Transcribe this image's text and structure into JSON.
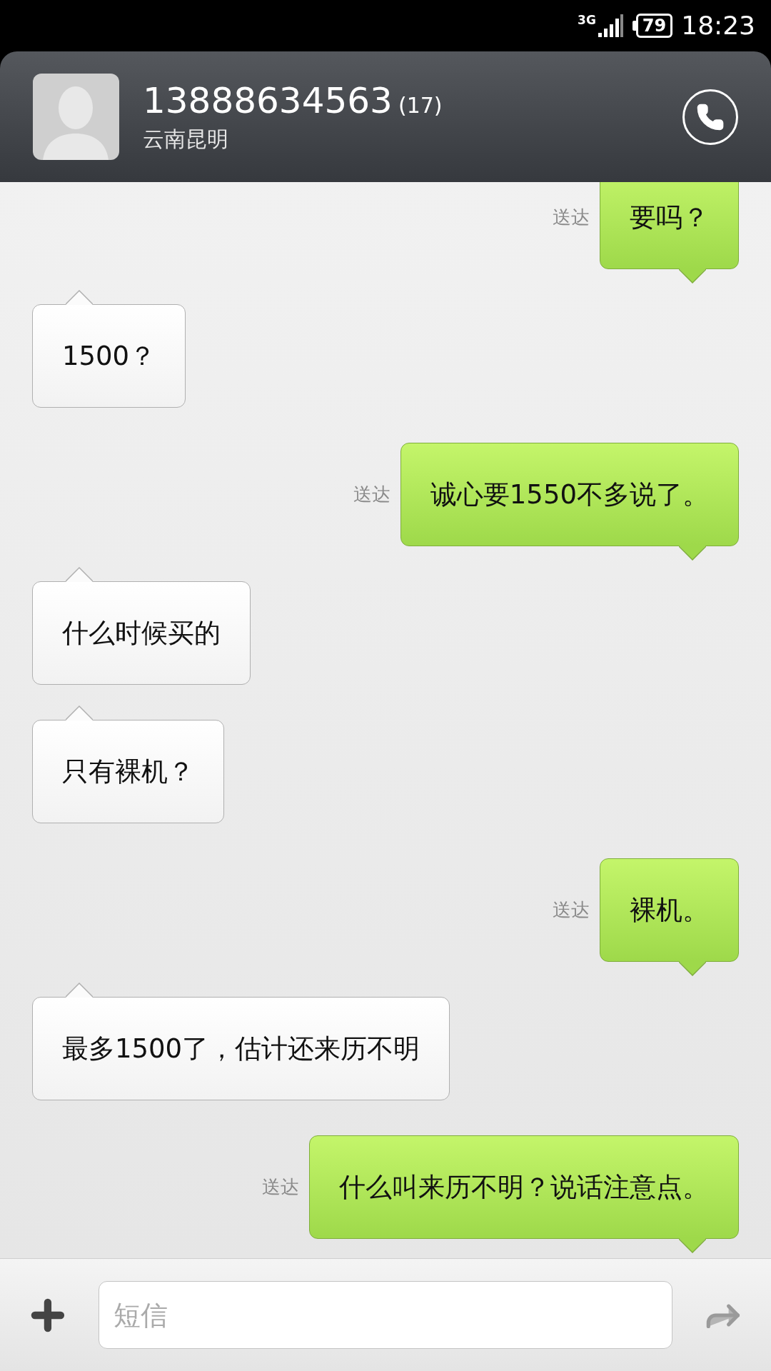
{
  "status_bar": {
    "network": "3G",
    "battery": "79",
    "time": "18:23"
  },
  "header": {
    "number": "13888634563",
    "count": "(17)",
    "location": "云南昆明"
  },
  "messages": [
    {
      "kind": "sent",
      "text": "要吗？",
      "status": "送达"
    },
    {
      "kind": "received",
      "text": "1500？"
    },
    {
      "kind": "sent",
      "text": "诚心要1550不多说了。",
      "status": "送达"
    },
    {
      "kind": "received",
      "text": "什么时候买的"
    },
    {
      "kind": "received",
      "text": "只有裸机？"
    },
    {
      "kind": "sent",
      "text": "裸机。",
      "status": "送达"
    },
    {
      "kind": "received",
      "text": "最多1500了，估计还来历不明"
    },
    {
      "kind": "sent",
      "text": "什么叫来历不明？说话注意点。",
      "status": "送达"
    }
  ],
  "composer": {
    "placeholder": "短信"
  }
}
